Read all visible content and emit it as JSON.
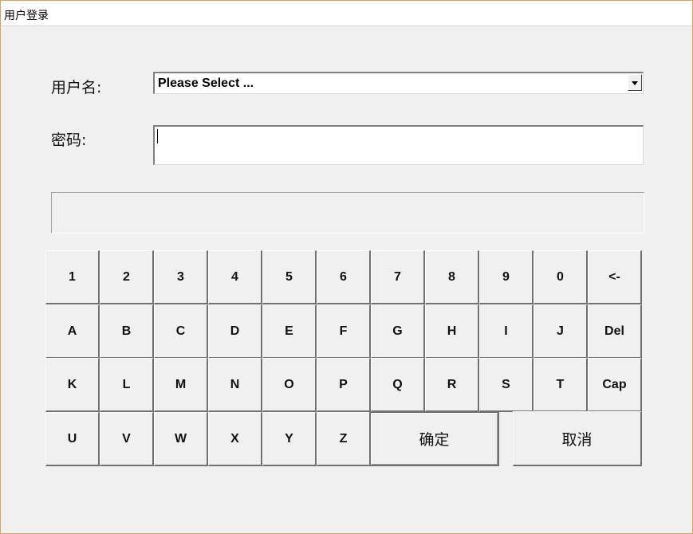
{
  "window": {
    "title": "用户登录"
  },
  "form": {
    "username_label": "用户名:",
    "username_value": "Please Select ...",
    "password_label": "密码:",
    "password_value": "",
    "message": ""
  },
  "keyboard": {
    "row1": [
      "1",
      "2",
      "3",
      "4",
      "5",
      "6",
      "7",
      "8",
      "9",
      "0",
      "<-"
    ],
    "row2": [
      "A",
      "B",
      "C",
      "D",
      "E",
      "F",
      "G",
      "H",
      "I",
      "J",
      "Del"
    ],
    "row3": [
      "K",
      "L",
      "M",
      "N",
      "O",
      "P",
      "Q",
      "R",
      "S",
      "T",
      "Cap"
    ],
    "row4": [
      "U",
      "V",
      "W",
      "X",
      "Y",
      "Z"
    ],
    "ok_label": "确定",
    "cancel_label": "取消"
  },
  "icons": {
    "combo_arrow": "chevron-down-icon"
  }
}
